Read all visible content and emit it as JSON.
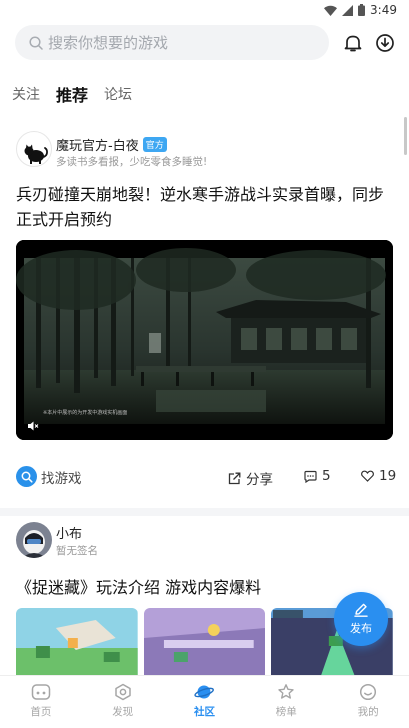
{
  "status_bar": {
    "time": "3:49"
  },
  "search": {
    "placeholder": "搜索你想要的游戏"
  },
  "tabs": [
    {
      "label": "关注",
      "active": false
    },
    {
      "label": "推荐",
      "active": true
    },
    {
      "label": "论坛",
      "active": false
    }
  ],
  "post1": {
    "author": "魔玩官方-白夜",
    "badge": "官方",
    "signature": "多读书多看报，少吃零食多睡觉!",
    "title": "兵刃碰撞天崩地裂！逆水寒手游战斗实录首曝，同步正式开启预约",
    "video_caption": "※本片中展示的为开发中游戏实机画面",
    "find_game": "找游戏",
    "share": "分享",
    "comments": "5",
    "likes": "19"
  },
  "post2": {
    "author": "小布",
    "signature": "暂无签名",
    "title": "《捉迷藏》玩法介绍 游戏内容爆料"
  },
  "fab": {
    "label": "发布"
  },
  "bottom_nav": [
    {
      "label": "首页",
      "icon": "gamepad-icon",
      "active": false
    },
    {
      "label": "发现",
      "icon": "discover-icon",
      "active": false
    },
    {
      "label": "社区",
      "icon": "planet-icon",
      "active": true
    },
    {
      "label": "榜单",
      "icon": "ranking-icon",
      "active": false
    },
    {
      "label": "我的",
      "icon": "smile-icon",
      "active": false
    }
  ],
  "colors": {
    "accent": "#2a8ff0",
    "badge": "#3ea7f2"
  }
}
